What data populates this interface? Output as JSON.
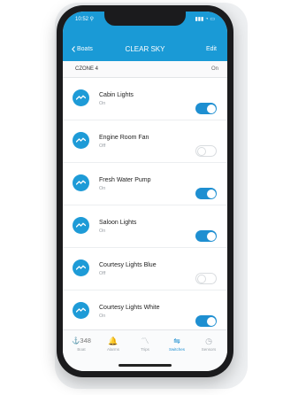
{
  "status": {
    "time": "10:52 ⚲",
    "icons": "▮▮▮ ◔ ▭"
  },
  "nav": {
    "back_label": "Boats",
    "title": "CLEAR SKY",
    "edit_label": "Edit"
  },
  "zone": {
    "name": "CZONE 4",
    "state": "On"
  },
  "items": [
    {
      "label": "Cabin Lights",
      "state": "On",
      "on": true
    },
    {
      "label": "Engine Room Fan",
      "state": "Off",
      "on": false
    },
    {
      "label": "Fresh Water Pump",
      "state": "On",
      "on": true
    },
    {
      "label": "Saloon Lights",
      "state": "On",
      "on": true
    },
    {
      "label": "Courtesy Lights Blue",
      "state": "Off",
      "on": false
    },
    {
      "label": "Courtesy Lights White",
      "state": "On",
      "on": true
    }
  ],
  "tabbar": {
    "tabs": [
      {
        "key": "boat",
        "glyph": "⚓348",
        "label": "Boat"
      },
      {
        "key": "alarms",
        "glyph": "🔔",
        "label": "Alarms"
      },
      {
        "key": "trips",
        "glyph": "〽",
        "label": "Trips"
      },
      {
        "key": "switches",
        "glyph": "⇋",
        "label": "Switches"
      },
      {
        "key": "sensors",
        "glyph": "◷",
        "label": "Sensors"
      }
    ],
    "active": "switches"
  },
  "colors": {
    "header": "#1a9ad6",
    "accent": "#1e8fd1",
    "icon": "#1e9bd7"
  }
}
